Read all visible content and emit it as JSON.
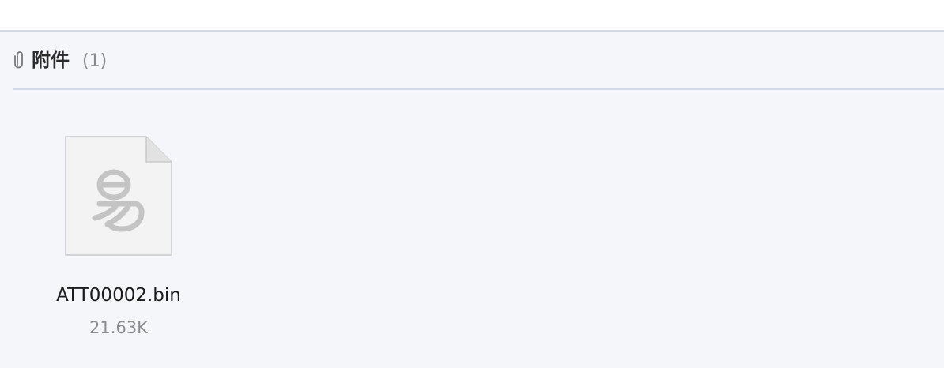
{
  "attachments": {
    "title": "附件",
    "count": "(1)",
    "icon": "paperclip-icon",
    "files": [
      {
        "name": "ATT00002.bin",
        "size": "21.63K",
        "icon": "file-icon",
        "logo_text": "易"
      }
    ]
  },
  "colors": {
    "panel_background": "#f4f6fa",
    "divider": "#d3dae5",
    "title_text": "#2b2b2b",
    "muted_text": "#8c8c8c"
  }
}
